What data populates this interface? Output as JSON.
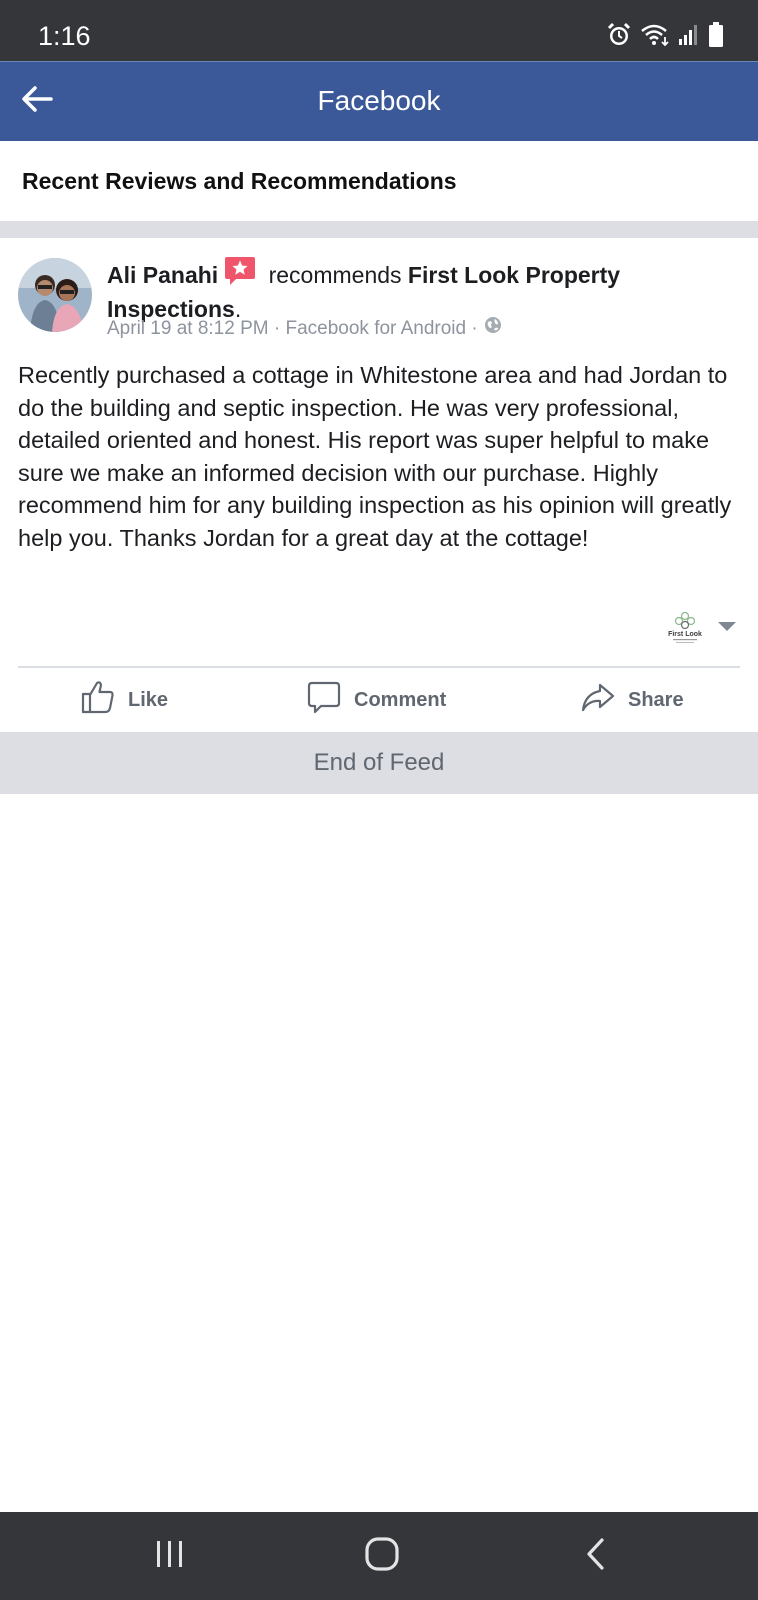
{
  "status_bar": {
    "time": "1:16",
    "icons": [
      "alarm-icon",
      "wifi-icon",
      "signal-icon",
      "battery-icon"
    ]
  },
  "app_bar": {
    "title": "Facebook",
    "back_icon": "arrow-left-icon"
  },
  "section": {
    "title": "Recent Reviews and Recommendations"
  },
  "post": {
    "author": "Ali Panahi",
    "verb": "recommends",
    "business": "First Look Property Inspections",
    "period": ".",
    "meta": "April 19 at 8:12 PM · Facebook for Android ·",
    "body": "Recently purchased a cottage in Whitestone area and had Jordan to do the building and septic inspection. He was very professional, detailed oriented and honest. His report was super helpful to make sure we make an informed decision with our purchase. Highly recommend him for any building inspection as his opinion will greatly help you. Thanks Jordan for a great day at the cottage!",
    "page_logo_text": "First Look"
  },
  "actions": {
    "like": "Like",
    "comment": "Comment",
    "share": "Share"
  },
  "end_of_feed": "End of Feed",
  "colors": {
    "facebook_blue": "#3b5998",
    "recommend_red": "#f0566b",
    "gray_text": "#606770"
  }
}
